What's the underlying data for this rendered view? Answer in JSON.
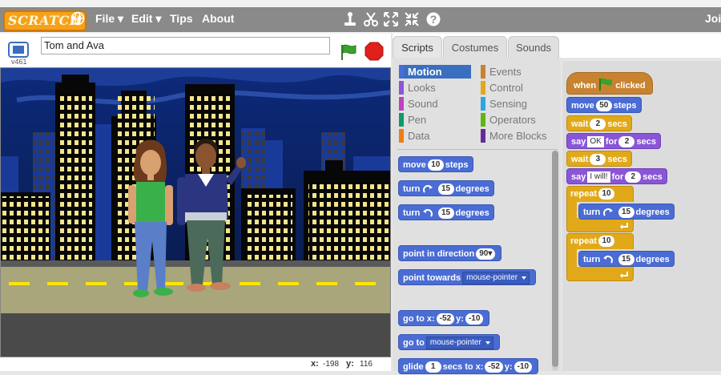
{
  "menubar": {
    "logo": "SCRATCH",
    "items": [
      "File ▾",
      "Edit ▾",
      "Tips",
      "About"
    ],
    "join": "Joi"
  },
  "stage": {
    "version": "v461",
    "project_title": "Tom and Ava",
    "coords": {
      "x_label": "x:",
      "x_value": "-198",
      "y_label": "y:",
      "y_value": "116"
    }
  },
  "tabs": [
    "Scripts",
    "Costumes",
    "Sounds"
  ],
  "categories": {
    "left": [
      {
        "label": "Motion",
        "color": "#4a6cd4"
      },
      {
        "label": "Looks",
        "color": "#8a55d7"
      },
      {
        "label": "Sound",
        "color": "#bb42c3"
      },
      {
        "label": "Pen",
        "color": "#0e9a6c"
      },
      {
        "label": "Data",
        "color": "#ee7d16"
      }
    ],
    "right": [
      {
        "label": "Events",
        "color": "#c88330"
      },
      {
        "label": "Control",
        "color": "#e1a91a"
      },
      {
        "label": "Sensing",
        "color": "#2ca5e2"
      },
      {
        "label": "Operators",
        "color": "#5cb712"
      },
      {
        "label": "More Blocks",
        "color": "#632d99"
      }
    ]
  },
  "palette_blocks": {
    "move": {
      "label": "move",
      "value": "10",
      "suffix": "steps"
    },
    "turn_cw": {
      "label": "turn",
      "value": "15",
      "suffix": "degrees"
    },
    "turn_ccw": {
      "label": "turn",
      "value": "15",
      "suffix": "degrees"
    },
    "point_dir": {
      "label": "point in direction",
      "value": "90▾"
    },
    "point_towards": {
      "label": "point towards",
      "value": "mouse-pointer"
    },
    "goto_xy": {
      "label": "go to x:",
      "x": "-52",
      "ylabel": "y:",
      "y": "-10"
    },
    "goto": {
      "label": "go to",
      "value": "mouse-pointer"
    },
    "glide": {
      "label": "glide",
      "secs": "1",
      "mid": "secs to x:",
      "x": "-52",
      "ylabel": "y:",
      "y": "-10"
    }
  },
  "script": {
    "hat": {
      "pre": "when",
      "post": "clicked"
    },
    "move": {
      "label": "move",
      "value": "50",
      "suffix": "steps"
    },
    "wait1": {
      "label": "wait",
      "value": "2",
      "suffix": "secs"
    },
    "say1": {
      "label": "say",
      "text": "OK",
      "mid": "for",
      "value": "2",
      "suffix": "secs"
    },
    "wait2": {
      "label": "wait",
      "value": "3",
      "suffix": "secs"
    },
    "say2": {
      "label": "say",
      "text": "I will!",
      "mid": "for",
      "value": "2",
      "suffix": "secs"
    },
    "repeat1": {
      "label": "repeat",
      "value": "10"
    },
    "turn1": {
      "label": "turn",
      "value": "15",
      "suffix": "degrees"
    },
    "repeat2": {
      "label": "repeat",
      "value": "10"
    },
    "turn2": {
      "label": "turn",
      "value": "15",
      "suffix": "degrees"
    }
  }
}
